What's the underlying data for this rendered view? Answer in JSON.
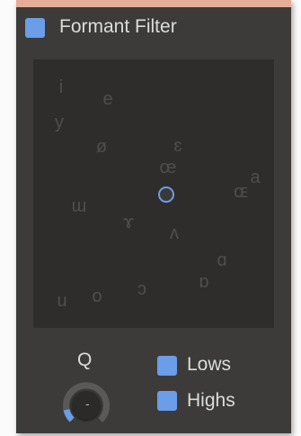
{
  "header": {
    "title": "Formant Filter",
    "enabled": true
  },
  "vowel_map": {
    "vowels": [
      "i",
      "e",
      "y",
      "ø",
      "ɛ",
      "œ",
      "ɶ",
      "a",
      "ɯ",
      "ɤ",
      "ʌ",
      "ɑ",
      "ɒ",
      "ɔ",
      "o",
      "u"
    ]
  },
  "q_knob": {
    "label": "Q",
    "value_text": "-",
    "level": 0.12
  },
  "toggles": {
    "lows": {
      "label": "Lows",
      "checked": true
    },
    "highs": {
      "label": "Highs",
      "checked": true
    }
  },
  "colors": {
    "accent": "#6b9de8",
    "panel": "#3c3b39",
    "pad": "#2e2d2b",
    "glyph": "#4f4e4b",
    "top_border": "#e6ac9a"
  }
}
